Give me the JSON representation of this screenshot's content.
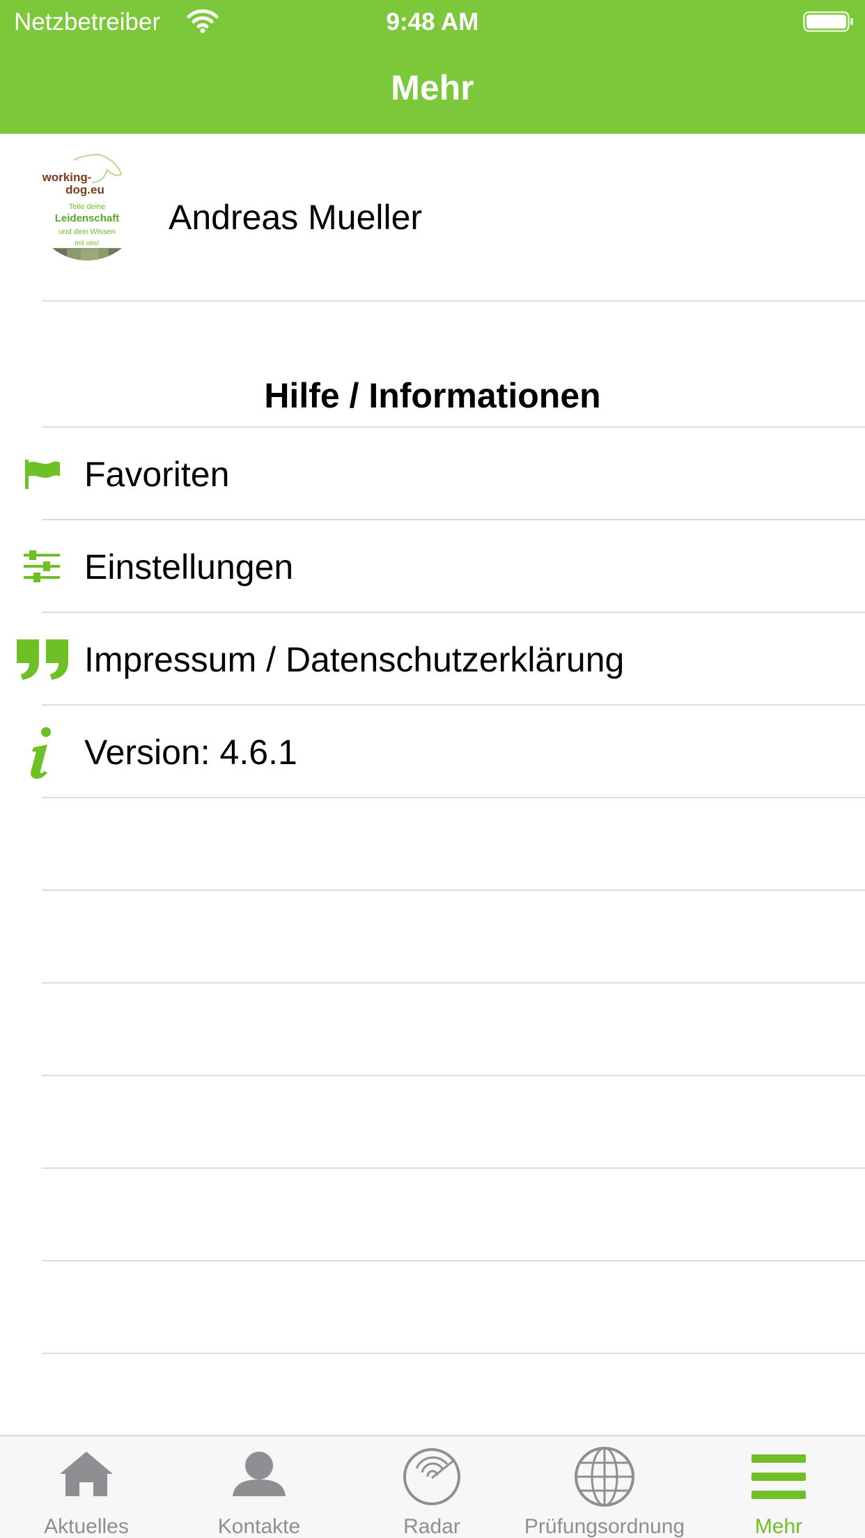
{
  "status_bar": {
    "carrier": "Netzbetreiber",
    "time": "9:48 AM"
  },
  "header": {
    "title": "Mehr"
  },
  "profile": {
    "name": "Andreas Mueller",
    "logo_text": {
      "line1": "working-",
      "line2": "dog.eu",
      "line3": "Teile deine",
      "line4": "Leidenschaft",
      "line5": "und dein Wissen",
      "line6": "mit uns!"
    }
  },
  "section": {
    "title": "Hilfe / Informationen"
  },
  "menu": [
    {
      "label": "Favoriten",
      "icon": "flag-icon"
    },
    {
      "label": "Einstellungen",
      "icon": "sliders-icon"
    },
    {
      "label": "Impressum / Datenschutzerklärung",
      "icon": "quote-icon"
    },
    {
      "label": "Version: 4.6.1",
      "icon": "info-icon"
    }
  ],
  "tabs": [
    {
      "label": "Aktuelles",
      "icon": "home-icon",
      "active": false
    },
    {
      "label": "Kontakte",
      "icon": "person-icon",
      "active": false
    },
    {
      "label": "Radar",
      "icon": "radar-icon",
      "active": false
    },
    {
      "label": "Prüfungsordnung",
      "icon": "globe-icon",
      "active": false
    },
    {
      "label": "Mehr",
      "icon": "hamburger-menu-icon",
      "active": true
    }
  ],
  "colors": {
    "accent": "#7cc83a",
    "icon_green": "#6fbf26",
    "tab_inactive": "#8e8e93",
    "separator": "#dcdcdc"
  }
}
